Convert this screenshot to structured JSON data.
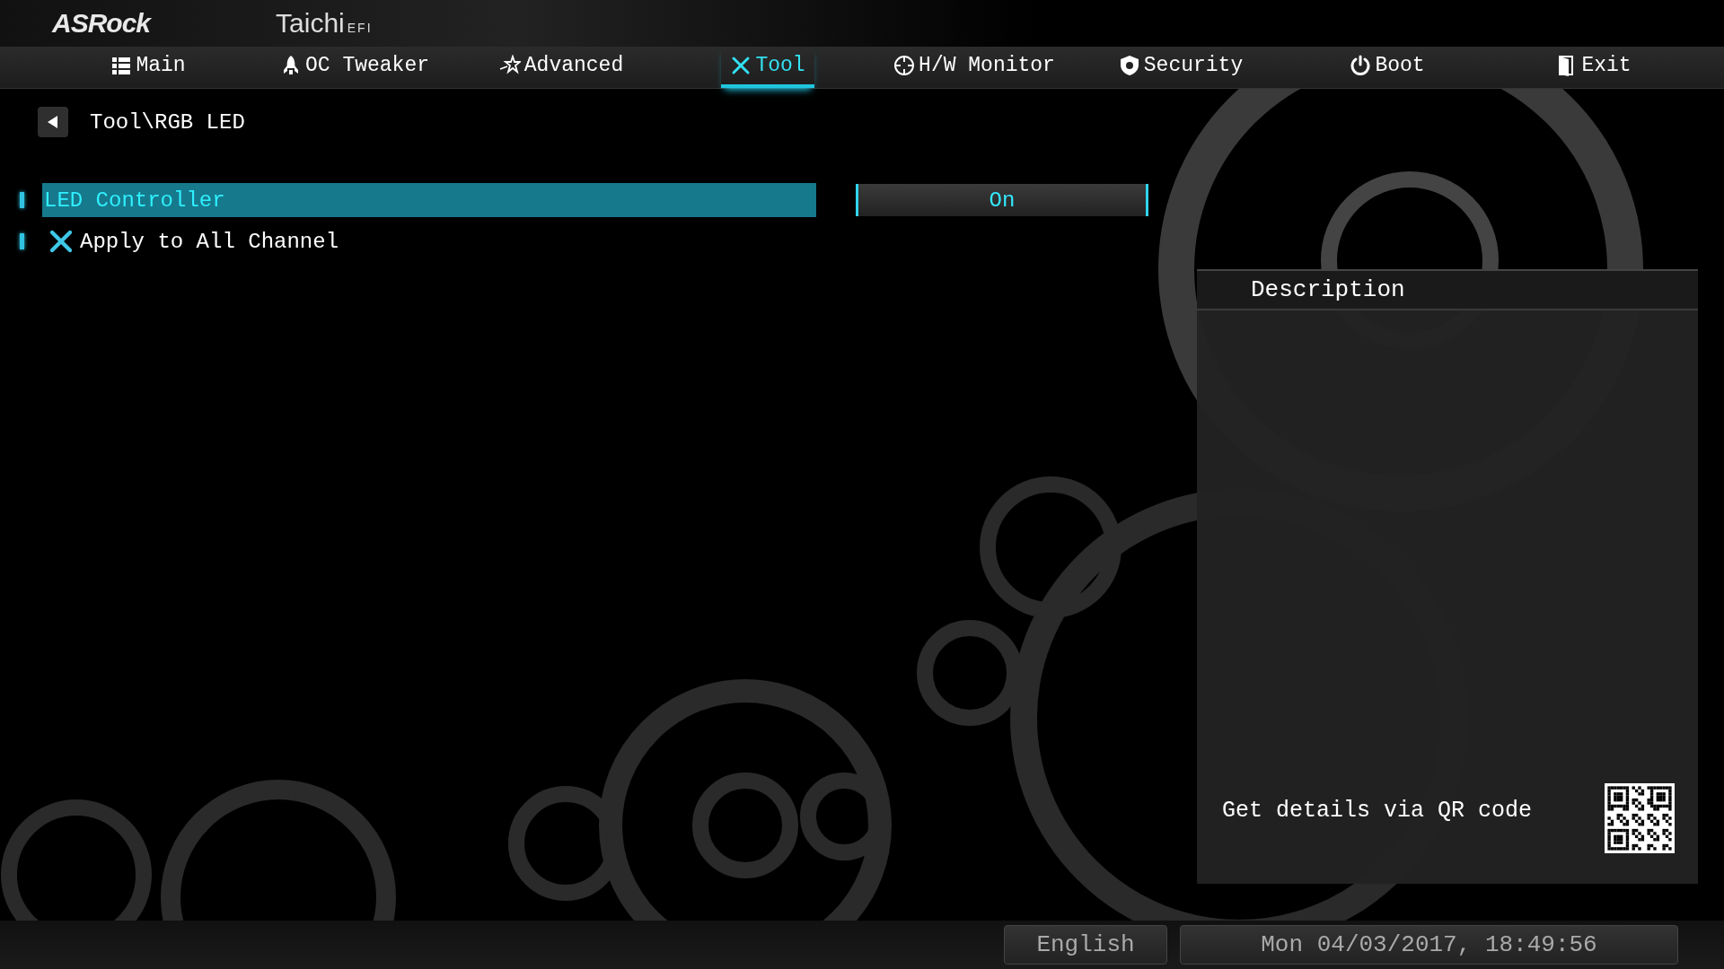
{
  "header": {
    "brand": "ASRock",
    "product": "Taichi",
    "product_suffix": "EFI"
  },
  "tabs": [
    {
      "label": "Main",
      "selected": false
    },
    {
      "label": "OC Tweaker",
      "selected": false
    },
    {
      "label": "Advanced",
      "selected": false
    },
    {
      "label": "Tool",
      "selected": true
    },
    {
      "label": "H/W Monitor",
      "selected": false
    },
    {
      "label": "Security",
      "selected": false
    },
    {
      "label": "Boot",
      "selected": false
    },
    {
      "label": "Exit",
      "selected": false
    }
  ],
  "breadcrumb": "Tool\\RGB LED",
  "items": [
    {
      "kind": "option",
      "label": "LED Controller",
      "value": "On",
      "selected": true
    },
    {
      "kind": "action",
      "label": "Apply to All Channel",
      "selected": false
    }
  ],
  "description": {
    "title": "Description",
    "qr_hint": "Get details via QR code"
  },
  "status_bar": {
    "language": "English",
    "datetime": "Mon 04/03/2017, 18:49:56"
  }
}
